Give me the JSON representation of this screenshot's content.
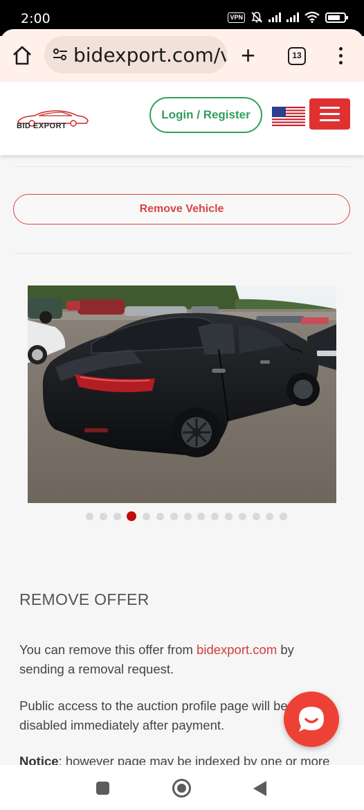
{
  "status_bar": {
    "time": "2:00",
    "vpn_label": "VPN",
    "icons": [
      "vpn-icon",
      "mute-icon",
      "signal-icon",
      "signal-icon",
      "wifi-icon",
      "battery-icon"
    ]
  },
  "browser": {
    "url": "bidexport.com/v",
    "tab_count": "13",
    "icons": [
      "home-icon",
      "site-settings-icon",
      "new-tab-plus-icon",
      "tab-switcher-icon",
      "more-menu-icon"
    ]
  },
  "header": {
    "logo_text": "BID EXPORT",
    "login_label": "Login / Register",
    "language_flag": "us-flag-icon",
    "menu_icon": "hamburger-icon",
    "colors": {
      "login_green": "#2f9e5a",
      "menu_red": "#e03131"
    }
  },
  "remove_button": {
    "label": "Remove Vehicle"
  },
  "gallery": {
    "image_alt": "Black sedan, rear three-quarter view in a lot",
    "total_images": 15,
    "active_index": 3
  },
  "remove_offer": {
    "title": "REMOVE OFFER",
    "p1_before": "You can remove this offer from ",
    "p1_link": "bidexport.com",
    "p1_after": " by sending a removal request.",
    "p2": "Public access to the auction profile page will be disabled immediately after payment.",
    "notice_label": "Notice",
    "notice_text": ": however page may be indexed by one or more"
  },
  "chat": {
    "icon": "chat-bubble-icon",
    "color": "#ee4136"
  },
  "nav_bar": {
    "icons": [
      "recents-square-icon",
      "home-circle-icon",
      "back-triangle-icon"
    ]
  }
}
